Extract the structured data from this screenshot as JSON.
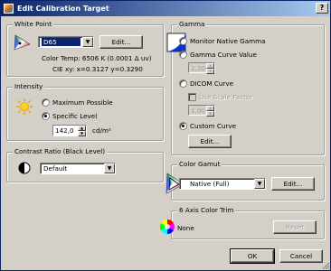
{
  "window": {
    "title": "Edit Calibration Target",
    "help_label": "?"
  },
  "white_point": {
    "legend": "White Point",
    "selected": "D65",
    "edit_label": "Edit...",
    "color_temp": "Color Temp:  6506 K (0.0001 Δ uv)",
    "cie": "CIE xy:  x=0.3127 y=0.3290"
  },
  "intensity": {
    "legend": "Intensity",
    "option_max": "Maximum Possible",
    "option_specific": "Specific Level",
    "selected": "specific",
    "level_value": "142,0",
    "unit": "cd/m²"
  },
  "contrast": {
    "legend": "Contrast Ratio (Black Level)",
    "selected": "Default"
  },
  "gamma": {
    "legend": "Gamma",
    "option_native": "Monitor Native Gamma",
    "option_curve": "Gamma Curve Value",
    "curve_value": "2,20",
    "option_dicom": "DICOM Curve",
    "use_scale_label": "Use Scale Factor",
    "scale_value": "1,00",
    "option_custom": "Custom Curve",
    "selected": "custom",
    "edit_label": "Edit..."
  },
  "color_gamut": {
    "legend": "Color Gamut",
    "selected": "Native (Full)",
    "edit_label": "Edit..."
  },
  "color_trim": {
    "legend": "6 Axis Color Trim",
    "value": "None",
    "reset_label": "Reset"
  },
  "footer": {
    "ok_label": "OK",
    "cancel_label": "Cancel"
  },
  "colors": {
    "title_start": "#0a246a",
    "title_end": "#a6caf0",
    "face": "#d4d0c8"
  }
}
